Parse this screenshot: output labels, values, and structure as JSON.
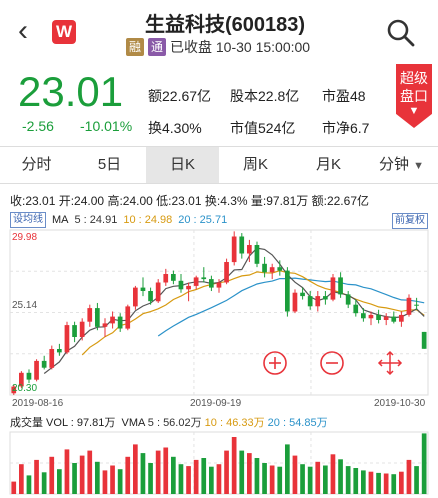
{
  "header": {
    "title": "生益科技(600183)",
    "tag1": "融",
    "tag2": "通",
    "status": "已收盘 10-30 15:00:00",
    "colors": {
      "tag1": "#b08a46",
      "tag2": "#8a5aa8"
    }
  },
  "quote": {
    "price": "23.01",
    "change": "-2.56",
    "change_pct": "-10.01%",
    "stats": {
      "amount": "额22.67亿",
      "equity": "股本22.8亿",
      "pe": "市盈48",
      "turnover": "换4.30%",
      "mktcap": "市值524亿",
      "pb": "市净6.7"
    },
    "super_label_1": "超级",
    "super_label_2": "盘口"
  },
  "tabs": [
    "分时",
    "5日",
    "日K",
    "周K",
    "月K",
    "分钟"
  ],
  "info": {
    "close": "收:23.01",
    "open": "开:24.00",
    "high": "高:24.00",
    "low": "低:23.01",
    "turnover": "换:4.3%",
    "volume": "量:97.81万",
    "amount": "额:22.67亿",
    "set_ma": "设均线",
    "ma_label": "MA",
    "ma5": "5 : 24.91",
    "ma10": "10 : 24.98",
    "ma20": "20 : 25.71",
    "fq": "前复权"
  },
  "vol_info": {
    "label": "成交量 VOL : 97.81万",
    "vma": "VMA",
    "vma5": "5 : 56.02万",
    "vma10": "10 : 46.33万",
    "vma20": "20 : 54.85万"
  },
  "axis": {
    "y_top": "29.98",
    "y_mid": "25.14",
    "y_bot": "20.30",
    "x_start": "2019-08-16",
    "x_mid": "2019-09-19",
    "x_end": "2019-10-30"
  },
  "chart_data": {
    "type": "candlestick",
    "ylim": [
      20.3,
      29.98
    ],
    "up_color": "#e8333a",
    "down_color": "#1b9e3b",
    "candles": [
      [
        20.4,
        20.9,
        20.3,
        20.8
      ],
      [
        20.8,
        21.7,
        20.7,
        21.6
      ],
      [
        21.6,
        21.8,
        21.0,
        21.2
      ],
      [
        21.2,
        22.4,
        21.1,
        22.3
      ],
      [
        22.3,
        22.6,
        21.8,
        21.9
      ],
      [
        21.9,
        23.2,
        21.8,
        23.0
      ],
      [
        23.0,
        23.3,
        22.6,
        22.8
      ],
      [
        22.8,
        24.6,
        22.7,
        24.4
      ],
      [
        24.4,
        24.6,
        23.4,
        23.7
      ],
      [
        23.7,
        24.8,
        23.5,
        24.6
      ],
      [
        24.6,
        25.6,
        24.3,
        25.4
      ],
      [
        25.4,
        25.7,
        24.1,
        24.3
      ],
      [
        24.3,
        24.8,
        23.7,
        24.5
      ],
      [
        24.5,
        25.2,
        24.2,
        24.9
      ],
      [
        24.9,
        25.1,
        24.0,
        24.2
      ],
      [
        24.2,
        25.6,
        24.1,
        25.5
      ],
      [
        25.5,
        26.7,
        25.3,
        26.6
      ],
      [
        26.6,
        27.2,
        26.1,
        26.4
      ],
      [
        26.4,
        26.6,
        25.6,
        25.8
      ],
      [
        25.8,
        27.1,
        25.7,
        26.9
      ],
      [
        26.9,
        27.7,
        26.7,
        27.4
      ],
      [
        27.4,
        27.6,
        26.8,
        27.0
      ],
      [
        27.0,
        27.4,
        26.3,
        26.5
      ],
      [
        26.5,
        26.9,
        25.8,
        26.7
      ],
      [
        26.7,
        27.3,
        26.5,
        27.2
      ],
      [
        27.2,
        27.8,
        26.9,
        27.1
      ],
      [
        27.1,
        27.3,
        26.4,
        26.6
      ],
      [
        26.6,
        27.1,
        26.3,
        26.9
      ],
      [
        26.9,
        28.3,
        26.8,
        28.1
      ],
      [
        28.1,
        29.9,
        27.9,
        29.6
      ],
      [
        29.6,
        29.8,
        28.3,
        28.6
      ],
      [
        28.6,
        29.4,
        28.1,
        29.1
      ],
      [
        29.1,
        29.3,
        27.8,
        28.0
      ],
      [
        28.0,
        28.4,
        27.2,
        27.5
      ],
      [
        27.5,
        28.0,
        27.1,
        27.8
      ],
      [
        27.8,
        28.2,
        27.3,
        27.6
      ],
      [
        27.6,
        27.8,
        24.9,
        25.2
      ],
      [
        25.2,
        26.5,
        25.1,
        26.3
      ],
      [
        26.3,
        26.6,
        25.9,
        26.1
      ],
      [
        26.1,
        26.4,
        25.3,
        25.5
      ],
      [
        25.5,
        26.4,
        25.2,
        26.1
      ],
      [
        26.1,
        26.4,
        25.6,
        25.9
      ],
      [
        25.9,
        27.4,
        25.8,
        27.2
      ],
      [
        27.2,
        27.5,
        26.0,
        26.2
      ],
      [
        26.2,
        26.4,
        25.4,
        25.6
      ],
      [
        25.6,
        25.9,
        24.9,
        25.1
      ],
      [
        25.1,
        25.4,
        24.6,
        24.8
      ],
      [
        24.8,
        25.2,
        24.4,
        25.0
      ],
      [
        25.0,
        25.3,
        24.5,
        24.7
      ],
      [
        24.7,
        25.1,
        24.4,
        24.9
      ],
      [
        24.9,
        25.2,
        24.5,
        24.6
      ],
      [
        24.6,
        25.2,
        24.3,
        25.0
      ],
      [
        25.0,
        26.2,
        24.9,
        26.0
      ],
      [
        25.6,
        26.0,
        25.3,
        25.57
      ],
      [
        24.0,
        24.0,
        23.01,
        23.01
      ]
    ],
    "volume_ylim": [
      0,
      100
    ],
    "volumes": [
      20,
      48,
      30,
      55,
      35,
      60,
      40,
      72,
      50,
      62,
      70,
      52,
      38,
      46,
      40,
      60,
      80,
      66,
      50,
      70,
      75,
      60,
      48,
      45,
      55,
      58,
      44,
      48,
      70,
      92,
      70,
      66,
      58,
      50,
      46,
      44,
      80,
      62,
      48,
      44,
      52,
      46,
      64,
      56,
      45,
      42,
      38,
      36,
      34,
      33,
      32,
      36,
      55,
      45,
      97.81
    ],
    "ma5": [
      null,
      null,
      null,
      null,
      21.56,
      21.9,
      22.24,
      22.88,
      23.16,
      23.7,
      24.1,
      24.28,
      24.3,
      24.74,
      24.66,
      24.68,
      25.24,
      25.52,
      25.7,
      26.04,
      26.54,
      26.68,
      26.72,
      26.86,
      26.94,
      26.94,
      26.84,
      26.9,
      27.18,
      27.64,
      27.66,
      28.46,
      28.92,
      28.84,
      28.52,
      27.98,
      27.36,
      26.92,
      26.6,
      26.06,
      25.84,
      25.98,
      26.36,
      26.26,
      26.16,
      25.88,
      25.3,
      25.14,
      25.0,
      24.9,
      24.84,
      24.88,
      25.1,
      25.35,
      24.91
    ],
    "ma10": [
      null,
      null,
      null,
      null,
      null,
      null,
      null,
      null,
      null,
      22.65,
      23.1,
      23.38,
      23.72,
      23.95,
      24.38,
      24.49,
      24.76,
      25.07,
      25.19,
      25.36,
      25.58,
      25.9,
      26.1,
      26.36,
      26.49,
      26.67,
      26.79,
      26.89,
      26.95,
      27.13,
      27.29,
      27.34,
      27.52,
      27.47,
      27.46,
      27.59,
      27.48,
      27.44,
      27.24,
      26.97,
      26.72,
      26.54,
      26.44,
      26.31,
      26.12,
      25.92,
      25.76,
      25.63,
      25.47,
      25.41,
      25.31,
      25.21,
      25.28,
      25.3,
      24.98
    ],
    "ma20": [
      null,
      null,
      null,
      null,
      null,
      null,
      null,
      null,
      null,
      null,
      null,
      null,
      null,
      null,
      null,
      null,
      null,
      null,
      null,
      23.76,
      24.07,
      24.35,
      24.6,
      24.86,
      25.03,
      25.22,
      25.42,
      25.63,
      25.85,
      26.13,
      26.42,
      26.62,
      26.81,
      26.91,
      26.98,
      27.13,
      27.13,
      27.16,
      27.1,
      27.05,
      27.0,
      26.95,
      26.98,
      26.89,
      26.79,
      26.76,
      26.62,
      26.53,
      26.36,
      26.19,
      26.02,
      25.88,
      25.86,
      25.8,
      25.71
    ]
  }
}
